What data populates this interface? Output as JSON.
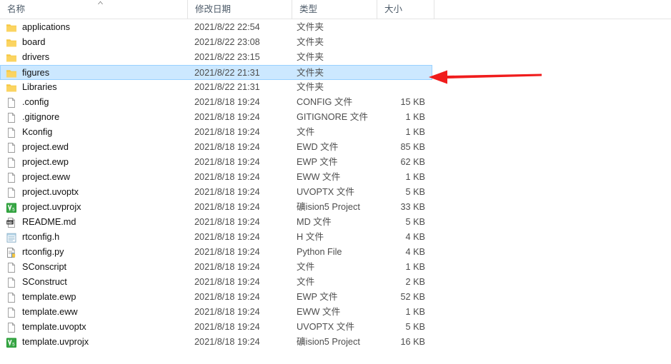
{
  "window": {
    "type": "file-explorer-list-view",
    "background_color": "#ffffff",
    "selection_color": "#cce8ff",
    "selection_border_color": "#99d1ff"
  },
  "columns": [
    {
      "key": "name",
      "label": "名称",
      "sorted": true,
      "sort_direction": "ascending"
    },
    {
      "key": "date",
      "label": "修改日期"
    },
    {
      "key": "type",
      "label": "类型"
    },
    {
      "key": "size",
      "label": "大小"
    }
  ],
  "annotation": {
    "shape": "arrow",
    "direction": "left",
    "color": "#f01c1c",
    "target_row": "figures"
  },
  "files": [
    {
      "name": "applications",
      "date": "2021/8/22 22:54",
      "type": "文件夹",
      "size": "",
      "icon": "folder-icon",
      "selected": false
    },
    {
      "name": "board",
      "date": "2021/8/22 23:08",
      "type": "文件夹",
      "size": "",
      "icon": "folder-icon",
      "selected": false
    },
    {
      "name": "drivers",
      "date": "2021/8/22 23:15",
      "type": "文件夹",
      "size": "",
      "icon": "folder-icon",
      "selected": false
    },
    {
      "name": "figures",
      "date": "2021/8/22 21:31",
      "type": "文件夹",
      "size": "",
      "icon": "folder-icon",
      "selected": true
    },
    {
      "name": "Libraries",
      "date": "2021/8/22 21:31",
      "type": "文件夹",
      "size": "",
      "icon": "folder-icon",
      "selected": false
    },
    {
      "name": ".config",
      "date": "2021/8/18 19:24",
      "type": "CONFIG 文件",
      "size": "15 KB",
      "icon": "blank-file-icon",
      "selected": false
    },
    {
      "name": ".gitignore",
      "date": "2021/8/18 19:24",
      "type": "GITIGNORE 文件",
      "size": "1 KB",
      "icon": "blank-file-icon",
      "selected": false
    },
    {
      "name": "Kconfig",
      "date": "2021/8/18 19:24",
      "type": "文件",
      "size": "1 KB",
      "icon": "blank-file-icon",
      "selected": false
    },
    {
      "name": "project.ewd",
      "date": "2021/8/18 19:24",
      "type": "EWD 文件",
      "size": "85 KB",
      "icon": "blank-file-icon",
      "selected": false
    },
    {
      "name": "project.ewp",
      "date": "2021/8/18 19:24",
      "type": "EWP 文件",
      "size": "62 KB",
      "icon": "blank-file-icon",
      "selected": false
    },
    {
      "name": "project.eww",
      "date": "2021/8/18 19:24",
      "type": "EWW 文件",
      "size": "1 KB",
      "icon": "blank-file-icon",
      "selected": false
    },
    {
      "name": "project.uvoptx",
      "date": "2021/8/18 19:24",
      "type": "UVOPTX 文件",
      "size": "5 KB",
      "icon": "blank-file-icon",
      "selected": false
    },
    {
      "name": "project.uvprojx",
      "date": "2021/8/18 19:24",
      "type": "礦ision5 Project",
      "size": "33 KB",
      "icon": "uvision5-icon",
      "selected": false
    },
    {
      "name": "README.md",
      "date": "2021/8/18 19:24",
      "type": "MD 文件",
      "size": "5 KB",
      "icon": "markdown-icon",
      "selected": false
    },
    {
      "name": "rtconfig.h",
      "date": "2021/8/18 19:24",
      "type": "H 文件",
      "size": "4 KB",
      "icon": "notepad-icon",
      "selected": false
    },
    {
      "name": "rtconfig.py",
      "date": "2021/8/18 19:24",
      "type": "Python File",
      "size": "4 KB",
      "icon": "python-file-icon",
      "selected": false
    },
    {
      "name": "SConscript",
      "date": "2021/8/18 19:24",
      "type": "文件",
      "size": "1 KB",
      "icon": "blank-file-icon",
      "selected": false
    },
    {
      "name": "SConstruct",
      "date": "2021/8/18 19:24",
      "type": "文件",
      "size": "2 KB",
      "icon": "blank-file-icon",
      "selected": false
    },
    {
      "name": "template.ewp",
      "date": "2021/8/18 19:24",
      "type": "EWP 文件",
      "size": "52 KB",
      "icon": "blank-file-icon",
      "selected": false
    },
    {
      "name": "template.eww",
      "date": "2021/8/18 19:24",
      "type": "EWW 文件",
      "size": "1 KB",
      "icon": "blank-file-icon",
      "selected": false
    },
    {
      "name": "template.uvoptx",
      "date": "2021/8/18 19:24",
      "type": "UVOPTX 文件",
      "size": "5 KB",
      "icon": "blank-file-icon",
      "selected": false
    },
    {
      "name": "template.uvprojx",
      "date": "2021/8/18 19:24",
      "type": "礦ision5 Project",
      "size": "16 KB",
      "icon": "uvision5-icon",
      "selected": false
    }
  ]
}
